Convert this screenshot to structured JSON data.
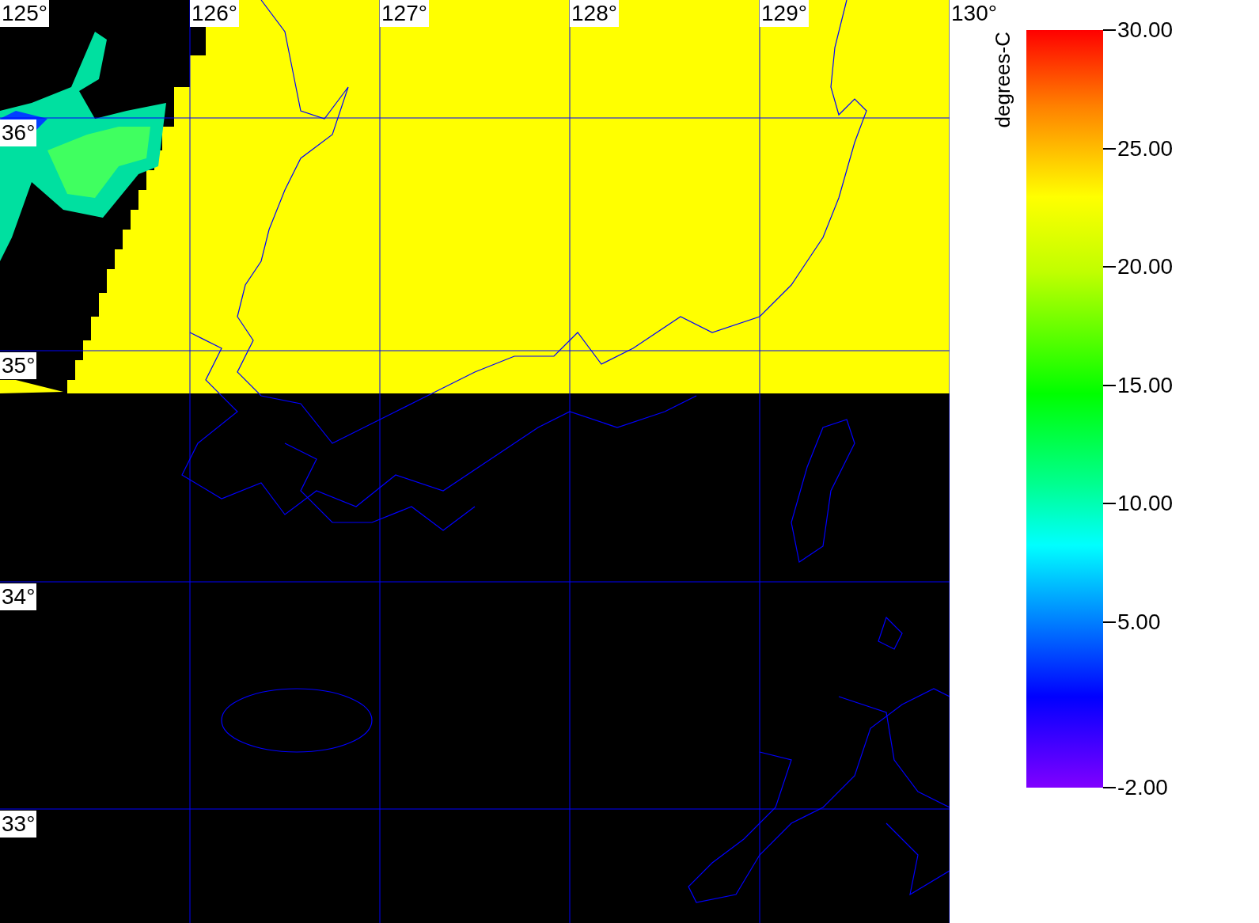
{
  "map": {
    "longitude_labels": [
      "125°",
      "126°",
      "127°",
      "128°",
      "129°",
      "130°"
    ],
    "latitude_labels": [
      "36°",
      "35°",
      "34°",
      "33°"
    ]
  },
  "colorbar": {
    "unit": "degrees-C",
    "ticks": [
      "30.00",
      "25.00",
      "20.00",
      "15.00",
      "10.00",
      "5.00",
      "-2.00"
    ]
  }
}
